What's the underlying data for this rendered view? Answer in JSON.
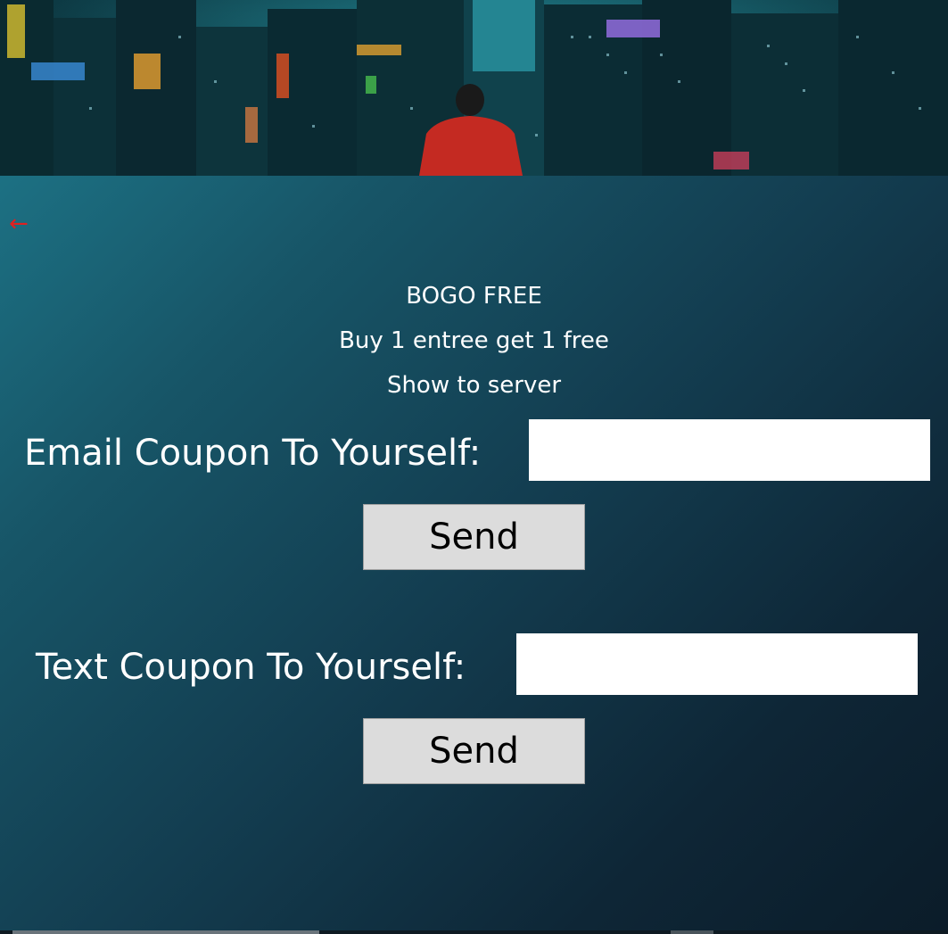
{
  "banner": {
    "image": "city-night-skyline-person-red-jacket"
  },
  "nav": {
    "back_symbol": "←",
    "back_color": "#e02020"
  },
  "coupon": {
    "title": "BOGO FREE",
    "description": "Buy 1 entree get 1 free",
    "note": "Show to server"
  },
  "email_form": {
    "label": "Email Coupon To Yourself:",
    "value": "",
    "send_label": "Send"
  },
  "text_form": {
    "label": "Text Coupon To Yourself:",
    "value": "",
    "send_label": "Send"
  },
  "colors": {
    "background_start": "#1f7d90",
    "background_end": "#0b1c29",
    "button_bg": "#dcdcdc",
    "text": "#ffffff"
  }
}
